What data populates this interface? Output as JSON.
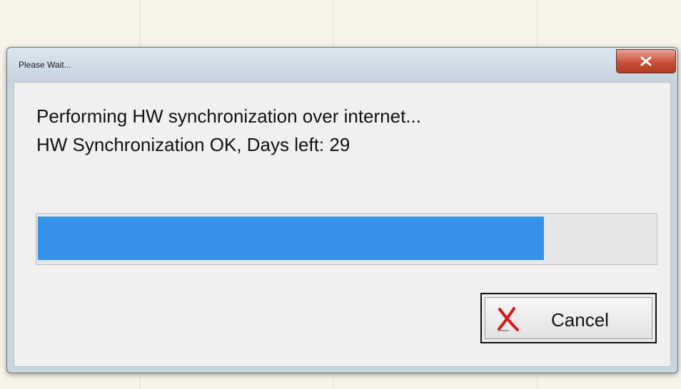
{
  "window": {
    "title": "Please Wait..."
  },
  "close_button": {
    "icon": "close-icon"
  },
  "messages": {
    "line1": "Performing HW synchronization over internet...",
    "line2": "HW Synchronization OK, Days left: 29"
  },
  "progress": {
    "value": 0.82
  },
  "cancel_button": {
    "label": "Cancel",
    "icon": "red-x-icon"
  },
  "colors": {
    "progress_fill": "#3492ea",
    "close_button": "#c9503b",
    "cancel_icon": "#d01818"
  }
}
